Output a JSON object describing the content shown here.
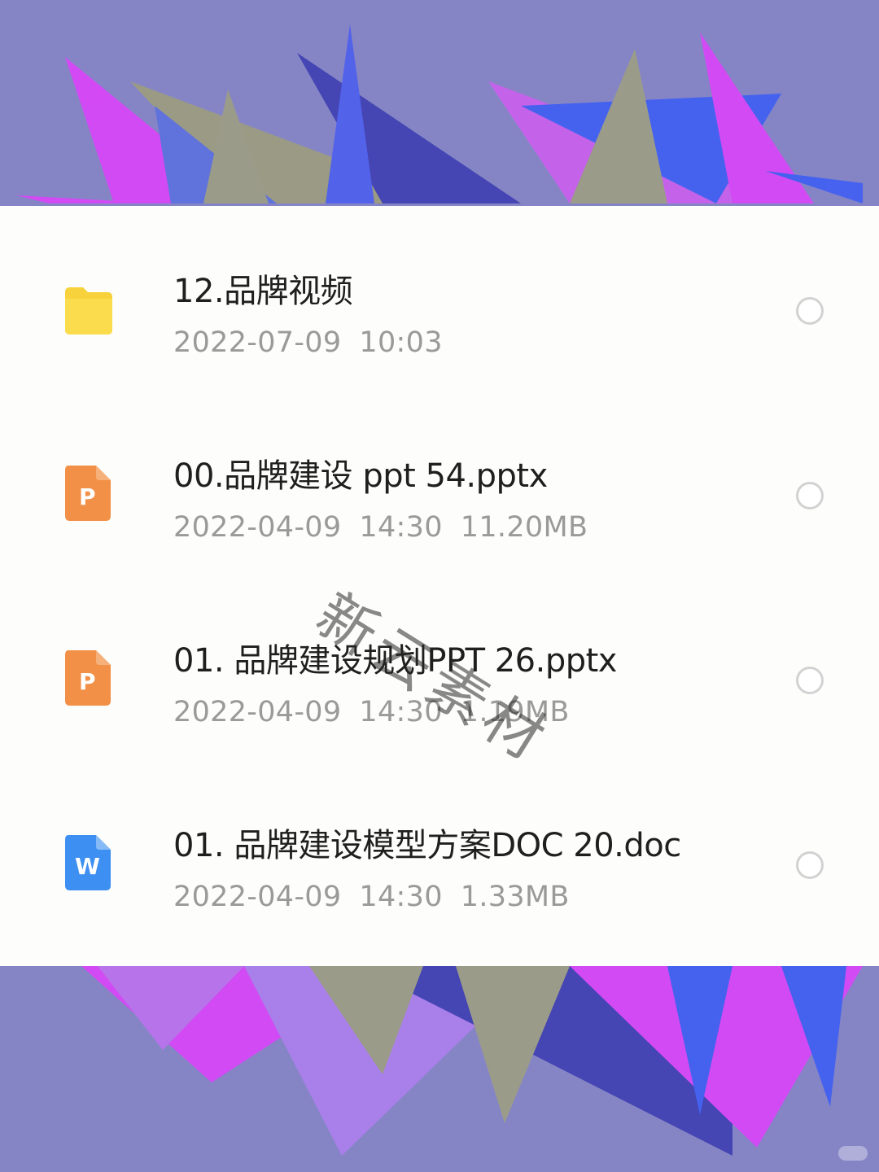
{
  "files": [
    {
      "name": "12.品牌视频",
      "date": "2022-07-09",
      "time": "10:03",
      "size": "",
      "icon": "folder-icon",
      "color": "#f7d23c"
    },
    {
      "name": "00.品牌建设 ppt 54.pptx",
      "date": "2022-04-09",
      "time": "14:30",
      "size": "11.20MB",
      "icon": "ppt-file-icon",
      "color": "#f19046"
    },
    {
      "name": "01. 品牌建设规划PPT 26.pptx",
      "date": "2022-04-09",
      "time": "14:30",
      "size": "1.19MB",
      "icon": "ppt-file-icon",
      "color": "#f19046"
    },
    {
      "name": "01. 品牌建设模型方案DOC 20.doc",
      "date": "2022-04-09",
      "time": "14:30",
      "size": "1.33MB",
      "icon": "word-file-icon",
      "color": "#3d8ff2"
    }
  ],
  "watermark": "新云素材",
  "icon_letters": {
    "ppt": "P",
    "word": "W"
  }
}
